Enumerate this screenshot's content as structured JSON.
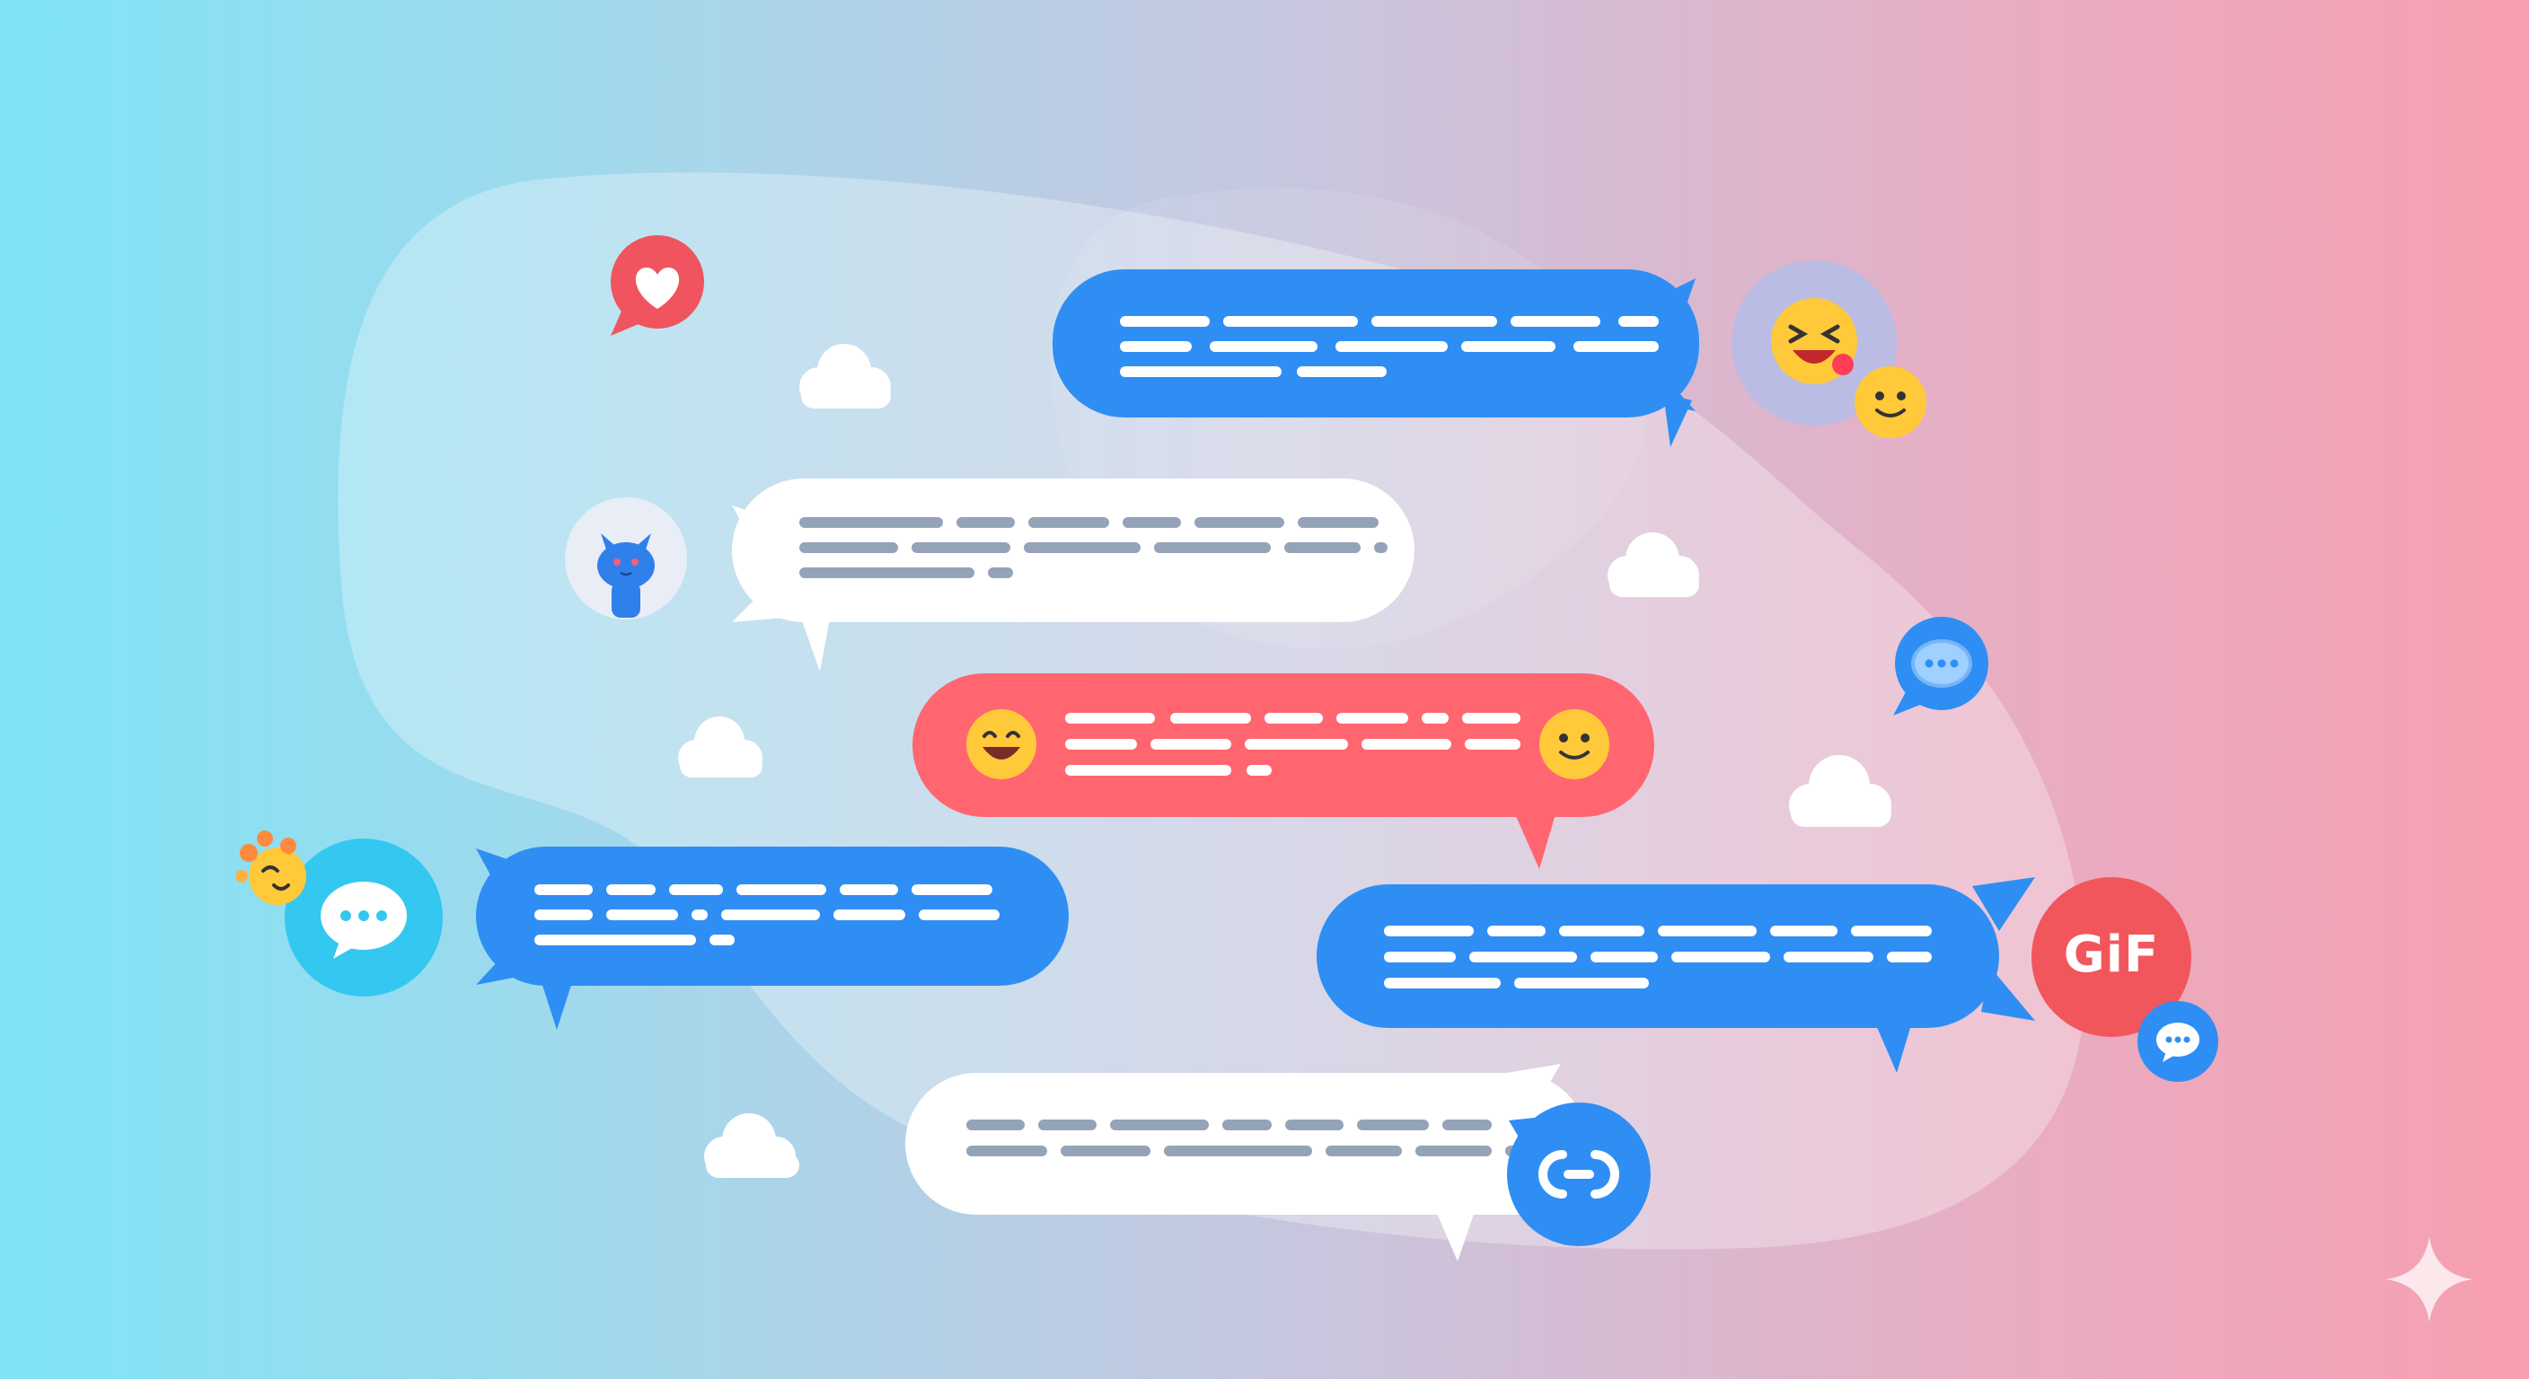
{
  "colors": {
    "blue_bubble": "#2f8ef3",
    "white_bubble": "#ffffff",
    "red_bubble": "#ff6670",
    "text_line_light": "#ffffff",
    "text_line_gray": "#95a3b8",
    "emoji_yellow": "#ffc93a",
    "heart_badge": "#f0545e",
    "gif_badge": "#f2565d",
    "chat_badge_blue": "#2f8ef3",
    "chat_badge_cyan": "#34c7f0"
  },
  "icons": {
    "heart_badge": "heart-icon",
    "cat_avatar": "cat-avatar-icon",
    "laughing_emoji": "laughing-face-icon",
    "smile_emoji": "smiling-face-icon",
    "grin_emoji": "grinning-face-icon",
    "party_emoji": "party-face-icon",
    "chat_badges": "chat-bubble-dots-icon",
    "link_badge": "link-icon",
    "sparkle": "sparkle-icon",
    "clouds": "cloud-icon"
  },
  "badges": {
    "gif_label": "GiF"
  }
}
